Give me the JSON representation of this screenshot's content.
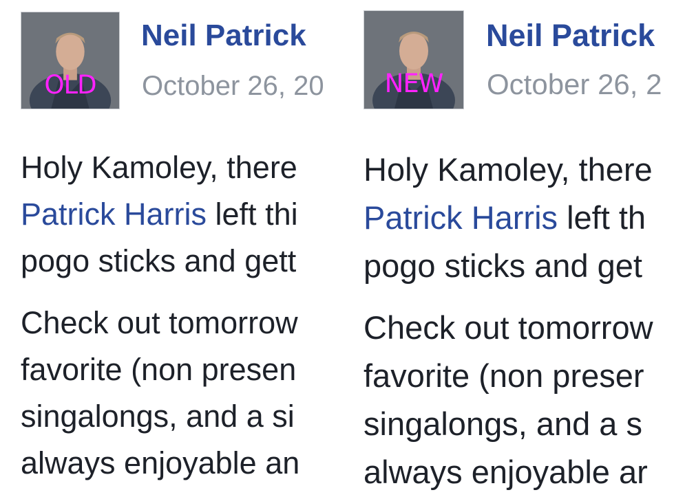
{
  "comparison": {
    "old": {
      "tag": "OLD",
      "author": "Neil Patrick",
      "date": "October 26, 20",
      "paragraph1": {
        "line1": "Holy Kamoley, there",
        "line2_link": "Patrick Harris",
        "line2_rest": " left thi",
        "line3": "pogo sticks and gett"
      },
      "paragraph2": {
        "line1": "Check out tomorrow",
        "line2": "favorite (non presen",
        "line3": "singalongs, and a si",
        "line4": "always enjoyable an"
      }
    },
    "new": {
      "tag": "NEW",
      "author": "Neil Patrick",
      "date": "October 26, 2",
      "paragraph1": {
        "line1": "Holy Kamoley, there",
        "line2_link": "Patrick Harris",
        "line2_rest": " left th",
        "line3": "pogo sticks and get"
      },
      "paragraph2": {
        "line1": "Check out tomorrow",
        "line2": "favorite (non preser",
        "line3": "singalongs, and a s",
        "line4": "always enjoyable ar"
      }
    }
  },
  "colors": {
    "author_link": "#2a4a9b",
    "date_text": "#8d949e",
    "body_text": "#1d2129",
    "overlay_label": "#ff22ff"
  }
}
